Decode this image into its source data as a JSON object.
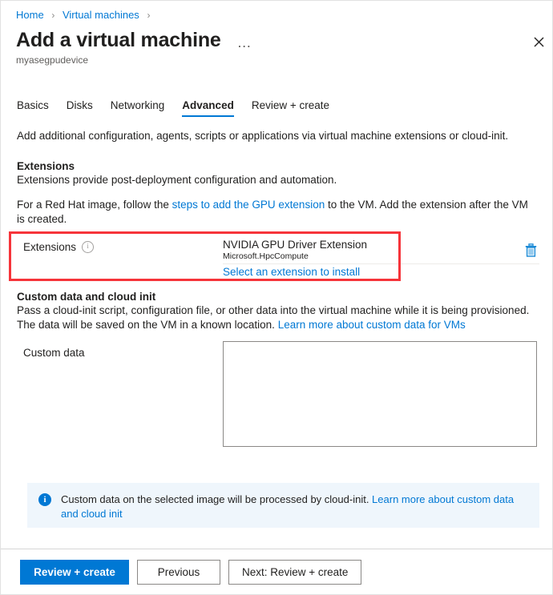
{
  "breadcrumb": {
    "items": [
      "Home",
      "Virtual machines"
    ],
    "separator": "›"
  },
  "header": {
    "title": "Add a virtual machine",
    "ellipsis": "…",
    "subtitle": "myasegpudevice",
    "close_label": "✕"
  },
  "tabs": [
    {
      "label": "Basics",
      "active": false
    },
    {
      "label": "Disks",
      "active": false
    },
    {
      "label": "Networking",
      "active": false
    },
    {
      "label": "Advanced",
      "active": true
    },
    {
      "label": "Review + create",
      "active": false
    }
  ],
  "main": {
    "intro": "Add additional configuration, agents, scripts or applications via virtual machine extensions or cloud-init.",
    "extensions": {
      "heading": "Extensions",
      "subheading": "Extensions provide post-deployment configuration and automation.",
      "note_before": "For a Red Hat image, follow the ",
      "note_link": "steps to add the GPU extension",
      "note_after": " to the VM. Add the extension after the VM is created.",
      "field_label": "Extensions",
      "extension_name": "NVIDIA GPU Driver Extension",
      "extension_publisher": "Microsoft.HpcCompute",
      "select_link": "Select an extension to install",
      "delete_icon": "trash-icon",
      "info_icon": "info-icon"
    },
    "custom_data": {
      "heading": "Custom data and cloud init",
      "sub_line1": "Pass a cloud-init script, configuration file, or other data into the virtual machine while it is being provisioned.",
      "sub_line2_before": "The data will be saved on the VM in a known location. ",
      "sub_line2_link": "Learn more about custom data for VMs",
      "field_label": "Custom data",
      "textarea_value": "",
      "textarea_placeholder": ""
    },
    "info_banner": {
      "icon": "info-filled-icon",
      "text_before": "Custom data on the selected image will be processed by cloud-init. ",
      "text_link": "Learn more about custom data and cloud init"
    }
  },
  "footer": {
    "primary_button": "Review + create",
    "previous_button": "Previous",
    "next_button": "Next: Review + create"
  },
  "colors": {
    "accent": "#0078d4",
    "highlight": "#f6343a",
    "banner_bg": "#eff6fc",
    "text": "#201f1e",
    "muted": "#605e5c"
  }
}
